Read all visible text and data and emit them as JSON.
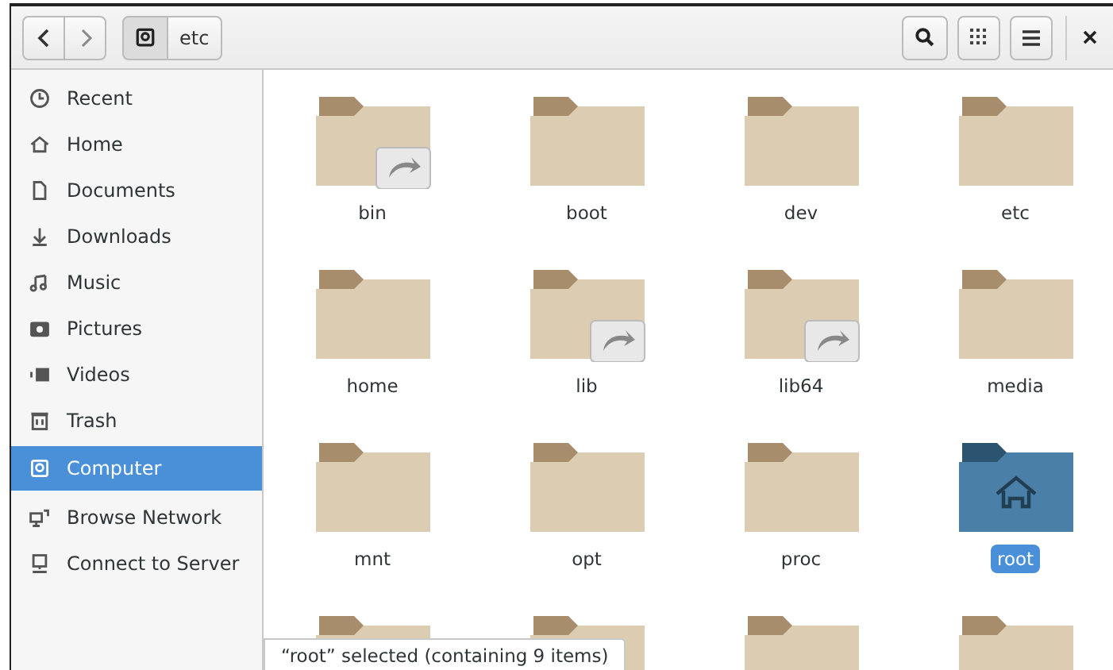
{
  "header": {
    "path": [
      {
        "kind": "drive"
      },
      {
        "kind": "text",
        "label": "etc"
      }
    ]
  },
  "sidebar": {
    "items": [
      {
        "label": "Recent",
        "selected": false
      },
      {
        "label": "Home",
        "selected": false
      },
      {
        "label": "Documents",
        "selected": false
      },
      {
        "label": "Downloads",
        "selected": false
      },
      {
        "label": "Music",
        "selected": false
      },
      {
        "label": "Pictures",
        "selected": false
      },
      {
        "label": "Videos",
        "selected": false
      },
      {
        "label": "Trash",
        "selected": false
      },
      {
        "label": "Computer",
        "selected": true
      },
      {
        "label": "Browse Network",
        "selected": false
      },
      {
        "label": "Connect to Server",
        "selected": false
      }
    ]
  },
  "files": [
    {
      "name": "bin",
      "kind": "folder",
      "symlink": true,
      "selected": false
    },
    {
      "name": "boot",
      "kind": "folder",
      "symlink": false,
      "selected": false
    },
    {
      "name": "dev",
      "kind": "folder",
      "symlink": false,
      "selected": false
    },
    {
      "name": "etc",
      "kind": "folder",
      "symlink": false,
      "selected": false
    },
    {
      "name": "home",
      "kind": "folder",
      "symlink": false,
      "selected": false
    },
    {
      "name": "lib",
      "kind": "folder",
      "symlink": true,
      "selected": false
    },
    {
      "name": "lib64",
      "kind": "folder",
      "symlink": true,
      "selected": false
    },
    {
      "name": "media",
      "kind": "folder",
      "symlink": false,
      "selected": false
    },
    {
      "name": "mnt",
      "kind": "folder",
      "symlink": false,
      "selected": false
    },
    {
      "name": "opt",
      "kind": "folder",
      "symlink": false,
      "selected": false
    },
    {
      "name": "proc",
      "kind": "folder",
      "symlink": false,
      "selected": false
    },
    {
      "name": "root",
      "kind": "home",
      "symlink": false,
      "selected": true
    },
    {
      "kind": "folder"
    },
    {
      "kind": "folder"
    },
    {
      "kind": "folder"
    },
    {
      "kind": "folder"
    }
  ],
  "status": "“root” selected (containing 9 items)"
}
